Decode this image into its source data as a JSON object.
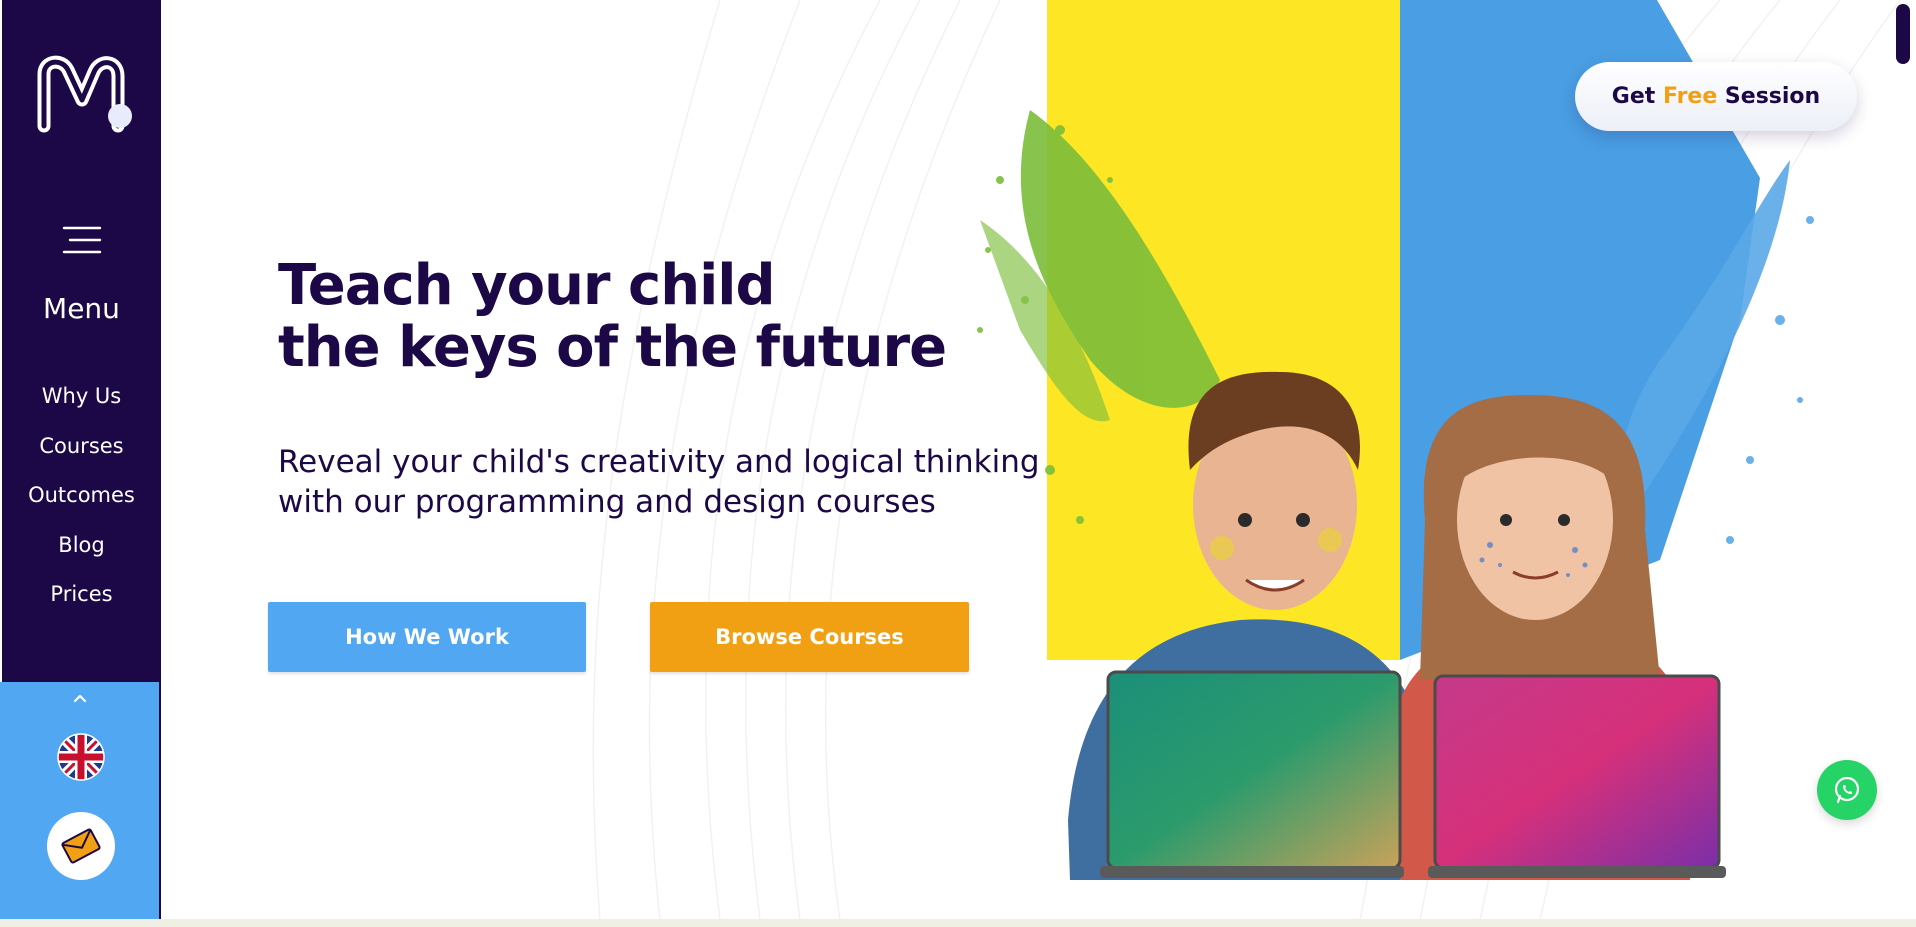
{
  "sidebar": {
    "menu_label": "Menu",
    "nav_items": [
      {
        "label": "Why Us"
      },
      {
        "label": "Courses"
      },
      {
        "label": "Outcomes"
      },
      {
        "label": "Blog"
      },
      {
        "label": "Prices"
      }
    ],
    "language": "English",
    "chevron_icon": "chevron-up-icon",
    "contact_icon": "envelope-icon"
  },
  "hero": {
    "title_line1": "Teach your child",
    "title_line2": "the keys of the future",
    "subtitle_line1": "Reveal your child's creativity and logical thinking",
    "subtitle_line2": "with our programming and design courses",
    "primary_button": "How We Work",
    "secondary_button": "Browse Courses"
  },
  "header": {
    "cta_prefix": "Get ",
    "cta_accent": "Free",
    "cta_suffix": " Session"
  },
  "colors": {
    "brand_dark": "#1c0846",
    "blue": "#52a7f2",
    "orange": "#f0a012",
    "yellow": "#fde725",
    "whatsapp": "#25d366"
  },
  "icons": {
    "whatsapp": "whatsapp-icon",
    "menu": "hamburger-icon"
  }
}
